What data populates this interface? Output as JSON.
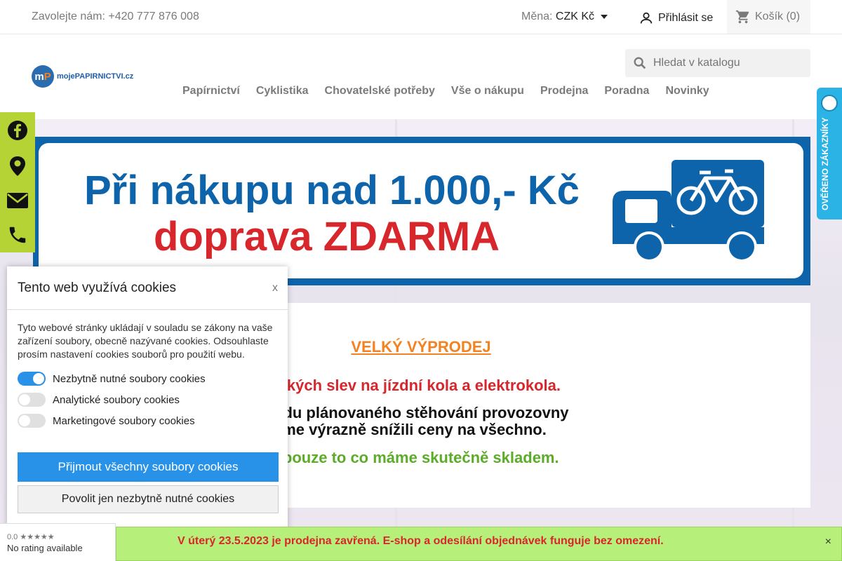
{
  "topbar": {
    "phone": "Zavolejte nám: +420 777 876 008",
    "currency_label": "Měna:",
    "currency_value": "CZK Kč",
    "login": "Přihlásit se",
    "cart": "Košík (0)"
  },
  "header": {
    "logo_text": "mojePAPIRNICTVI.cz",
    "search_placeholder": "Hledat v katalogu",
    "nav": [
      "Papírnictví",
      "Cyklistika",
      "Chovatelské potřeby",
      "Vše o nákupu",
      "Prodejna",
      "Poradna",
      "Novinky"
    ]
  },
  "banner": {
    "line1": "Při nákupu nad 1.000,- Kč",
    "line2": "doprava ZDARMA"
  },
  "content": {
    "title": "VELKÝ VÝPRODEJ",
    "red_line": "e velkých slev na jízdní kola a elektrokola.",
    "black_line1": "odu plánovaného stěhování provozovny",
    "black_line2": "sme výrazně snížili ceny na všechno.",
    "green_line": "me pouze to co máme skutečně skladem."
  },
  "verified": {
    "label": "OVĚŘENO ZÁKAZNÍKY"
  },
  "cookie": {
    "title": "Tento web využívá cookies",
    "close": "x",
    "description": "Tyto webové stránky ukládají v souladu se zákony na vaše zařízení soubory, obecně nazývané cookies. Odsouhlaste prosím nastavení cookies souborů pro použití webu.",
    "toggles": [
      {
        "label": "Nezbytně nutné soubory cookies",
        "on": true
      },
      {
        "label": "Analytické soubory cookies",
        "on": false
      },
      {
        "label": "Marketingové soubory cookies",
        "on": false
      }
    ],
    "accept_all": "Přijmout všechny soubory cookies",
    "necessary_only": "Povolit jen nezbytně nutné cookies"
  },
  "rating": {
    "score": "0.0 ★★★★★",
    "text": "No rating available"
  },
  "notice": {
    "message": "V úterý 23.5.2023 je prodejna zavřená. E-shop a odesílání objednávek funguje bez omezení.",
    "close": "×"
  },
  "colors": {
    "brand_blue": "#0d64aa",
    "brand_red": "#d7262c",
    "accent_orange": "#f58220",
    "green": "#5cac2a",
    "cookie_blue": "#2891e8",
    "social_green": "#b5d334"
  }
}
